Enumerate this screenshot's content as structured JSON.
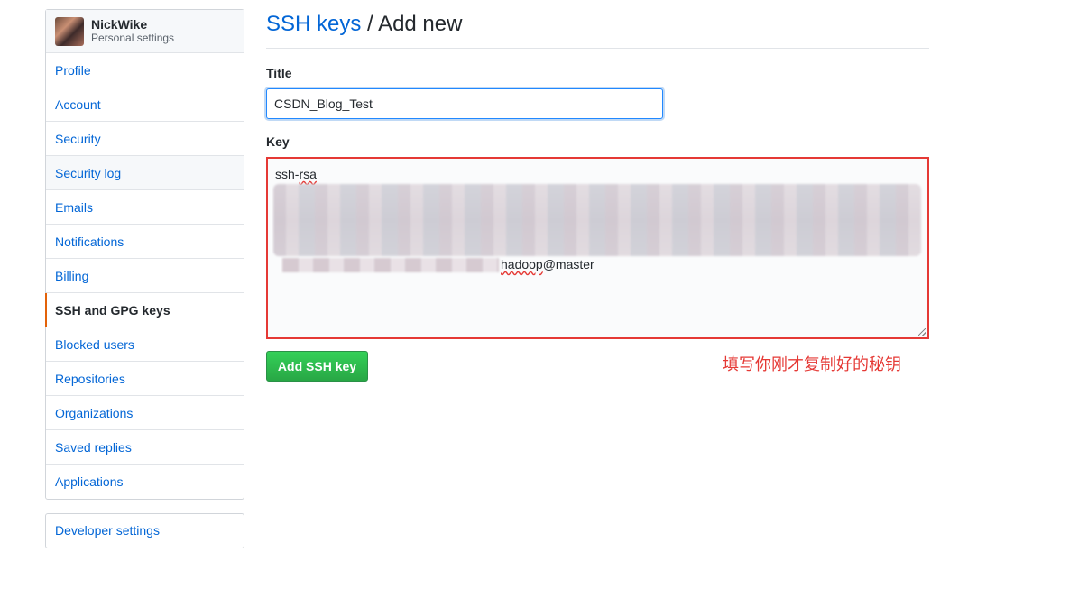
{
  "profile": {
    "name": "NickWike",
    "subtitle": "Personal settings"
  },
  "sidebar": {
    "items": [
      {
        "label": "Profile"
      },
      {
        "label": "Account"
      },
      {
        "label": "Security"
      },
      {
        "label": "Security log"
      },
      {
        "label": "Emails"
      },
      {
        "label": "Notifications"
      },
      {
        "label": "Billing"
      },
      {
        "label": "SSH and GPG keys"
      },
      {
        "label": "Blocked users"
      },
      {
        "label": "Repositories"
      },
      {
        "label": "Organizations"
      },
      {
        "label": "Saved replies"
      },
      {
        "label": "Applications"
      }
    ],
    "selected": "SSH and GPG keys",
    "developer_settings": "Developer settings"
  },
  "page": {
    "breadcrumb_link": "SSH keys",
    "separator": " / ",
    "title": "Add new"
  },
  "form": {
    "title_label": "Title",
    "title_value": "CSDN_Blog_Test",
    "key_label": "Key",
    "key_prefix": "ssh-",
    "key_prefix_squiggle": "rsa",
    "key_suffix_squiggle": "hadoop",
    "key_suffix": "@master",
    "submit_label": "Add SSH key"
  },
  "annotation": {
    "text": "填写你刚才复制好的秘钥",
    "color": "#e53935"
  },
  "colors": {
    "link": "#0366d6",
    "button_green": "#28a745",
    "highlight_border": "#e53935",
    "selected_marker": "#e36209"
  }
}
